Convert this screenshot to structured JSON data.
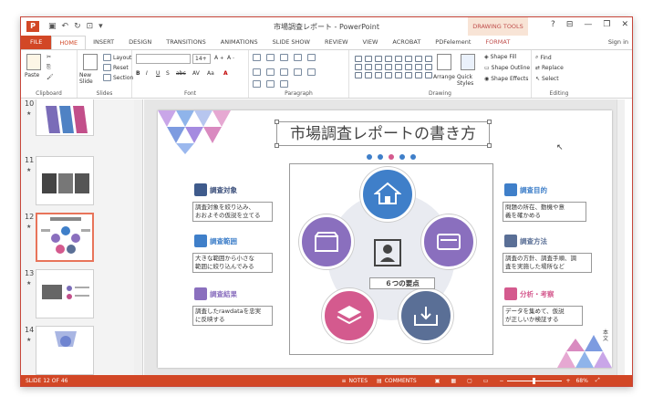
{
  "window": {
    "title": "市場調査レポート - PowerPoint",
    "contextual_tab": "DRAWING TOOLS",
    "help": "?",
    "sign_in": "Sign in"
  },
  "ribbon_tabs": [
    "FILE",
    "HOME",
    "INSERT",
    "DESIGN",
    "TRANSITIONS",
    "ANIMATIONS",
    "SLIDE SHOW",
    "REVIEW",
    "VIEW",
    "ACROBAT",
    "PDFelement",
    "FORMAT"
  ],
  "active_tab": "HOME",
  "ribbon": {
    "clipboard": {
      "label": "Clipboard",
      "paste": "Paste"
    },
    "slides": {
      "label": "Slides",
      "new_slide": "New Slide",
      "layout": "Layout",
      "reset": "Reset",
      "section": "Section"
    },
    "font": {
      "label": "Font",
      "font_name": "",
      "font_size": "14+"
    },
    "paragraph": {
      "label": "Paragraph"
    },
    "drawing": {
      "label": "Drawing",
      "arrange": "Arrange",
      "quick_styles": "Quick Styles",
      "shape_fill": "Shape Fill",
      "shape_outline": "Shape Outline",
      "shape_effects": "Shape Effects"
    },
    "editing": {
      "label": "Editing",
      "find": "Find",
      "replace": "Replace",
      "select": "Select"
    }
  },
  "thumbnails": [
    {
      "num": "10",
      "star": "★"
    },
    {
      "num": "11",
      "star": "★"
    },
    {
      "num": "12",
      "star": "★",
      "selected": true
    },
    {
      "num": "13",
      "star": "★"
    },
    {
      "num": "14",
      "star": "★"
    }
  ],
  "slide": {
    "title": "市場調査レポートの書き方",
    "center_label": "６つの要点",
    "left_items": [
      {
        "label": "調査対象",
        "desc1": "調査対象を絞り込み、",
        "desc2": "おおよその仮説を立てる"
      },
      {
        "label": "調査範囲",
        "desc1": "大きな範囲から小さな",
        "desc2": "範囲に絞り込んでみる"
      },
      {
        "label": "調査結果",
        "desc1": "調査したrawdataを忠実",
        "desc2": "に反映する"
      }
    ],
    "right_items": [
      {
        "label": "調査目的",
        "desc1": "問題の所在、動機や意",
        "desc2": "義を確かめる"
      },
      {
        "label": "調査方法",
        "desc1": "調査の方針、調査手順、調",
        "desc2": "査を実施した場所など"
      },
      {
        "label": "分析・考察",
        "desc1": "データを集めて、仮説",
        "desc2": "が正しいか検証する"
      }
    ],
    "side_text": "本文"
  },
  "status": {
    "slide_info": "SLIDE 12 OF 46",
    "notes": "NOTES",
    "comments": "COMMENTS",
    "zoom": "68%"
  },
  "colors": {
    "accent": "#d24726",
    "blue": "#3f7fc9",
    "purple": "#8a6fbe",
    "pink": "#d45a8e",
    "slate": "#5a6f96"
  }
}
